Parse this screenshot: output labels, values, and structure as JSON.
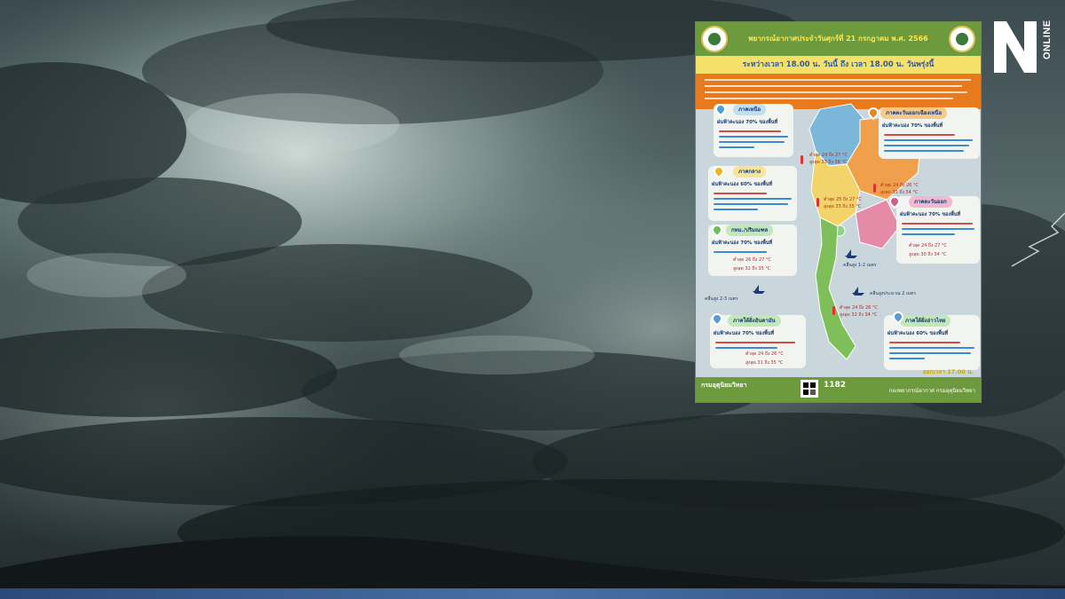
{
  "brand": {
    "logo_letter": "N",
    "logo_word": "ONLINE"
  },
  "infographic": {
    "title": "พยากรณ์อากาศประจำวันศุกร์ที่ 21 กรกฎาคม พ.ศ. 2566",
    "subtitle": "ระหว่างเวลา 18.00 น. วันนี้ ถึง เวลา 18.00 น. วันพรุ่งนี้",
    "regions": {
      "north": {
        "label": "ภาคเหนือ",
        "rain": "ฝนฟ้าคะนอง 70% ของพื้นที่",
        "temp": "ต่ำสุด 24 ถึง 27 °C",
        "temp_high": "สูงสุด 33 ถึง 36 °C"
      },
      "northeast": {
        "label": "ภาคตะวันออกเฉียงเหนือ",
        "rain": "ฝนฟ้าคะนอง 70% ของพื้นที่",
        "temp": "ต่ำสุด 24 ถึง 26 °C",
        "temp_high": "สูงสุด 31 ถึง 34 °C"
      },
      "central": {
        "label": "ภาคกลาง",
        "rain": "ฝนฟ้าคะนอง 60% ของพื้นที่",
        "temp": "ต่ำสุด 25 ถึง 27 °C",
        "temp_high": "สูงสุด 33 ถึง 35 °C"
      },
      "east": {
        "label": "ภาคตะวันออก",
        "rain": "ฝนฟ้าคะนอง 70% ของพื้นที่",
        "temp": "ต่ำสุด 24 ถึง 27 °C",
        "temp_high": "สูงสุด 30 ถึง 34 °C"
      },
      "bangkok": {
        "label": "กทม./ปริมณฑล",
        "rain": "ฝนฟ้าคะนอง 70% ของพื้นที่",
        "temp": "ต่ำสุด 26 ถึง 27 °C",
        "temp_high": "สูงสุด 32 ถึง 35 °C"
      },
      "south_andaman": {
        "label": "ภาคใต้ฝั่งอันดามัน",
        "rain": "ฝนฟ้าคะนอง 70% ของพื้นที่",
        "temp": "ต่ำสุด 24 ถึง 26 °C",
        "temp_high": "สูงสุด 31 ถึง 35 °C"
      },
      "south_gulf": {
        "label": "ภาคใต้ฝั่งอ่าวไทย",
        "rain": "ฝนฟ้าคะนอง 60% ของพื้นที่",
        "temp": "ต่ำสุด 24 ถึง 26 °C",
        "temp_high": "สูงสุด 32 ถึง 34 °C"
      }
    },
    "waves": {
      "andaman": "คลื่นสูง 2-3 เมตร",
      "upper_gulf": "คลื่นสูง 1-2 เมตร",
      "lower_gulf": "คลื่นสูงประมาณ 2 เมตร"
    },
    "issued": "ออกเวลา 17.00 น.",
    "footer_left": "กรมอุตุนิยมวิทยา",
    "footer_num": "1182",
    "footer_right": "กองพยากรณ์อากาศ กรมอุตุนิยมวิทยา"
  },
  "colors": {
    "header": "#6d9a3d",
    "subtitle_bg": "#f5e06a",
    "desc_bg": "#e87a1e",
    "map_bg": "#c9d6dc",
    "north": "#7ab7d9",
    "northeast": "#f0a04b",
    "central": "#f2d46b",
    "east": "#e58ba8",
    "south": "#7fbf5a"
  }
}
